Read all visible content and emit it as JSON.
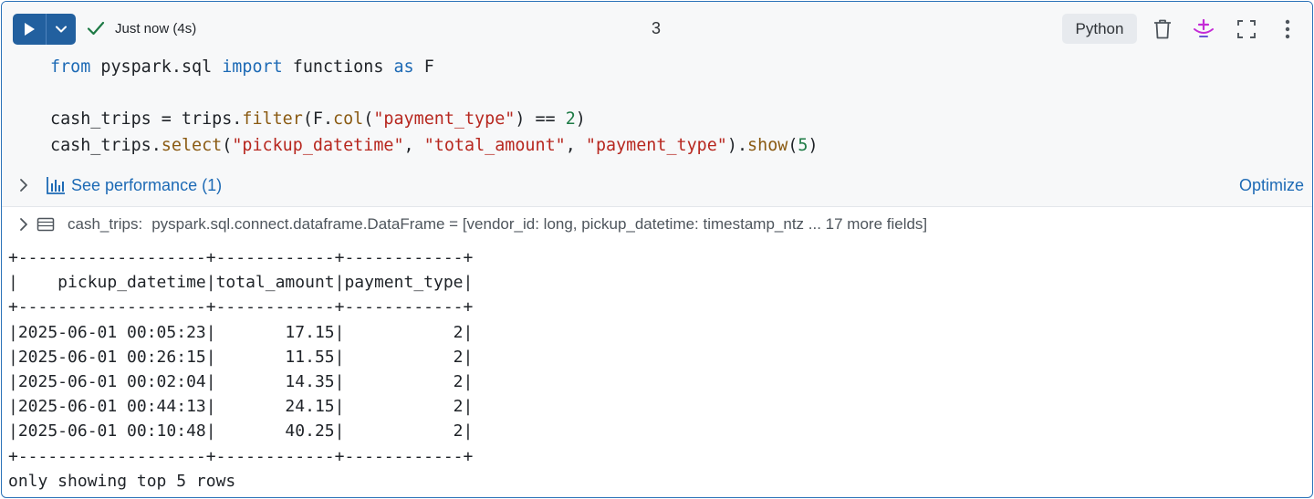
{
  "toolbar": {
    "status_text": "Just now (4s)",
    "cell_number": "3",
    "language": "Python",
    "icons": [
      "play-icon",
      "chevron-down-icon",
      "check-icon",
      "trash-icon",
      "assistant-sparkle-icon",
      "expand-icon",
      "more-vertical-icon"
    ]
  },
  "code": {
    "line1": {
      "kw_from": "from",
      "module": " pyspark.sql ",
      "kw_import": "import",
      "names": " functions ",
      "kw_as": "as",
      "alias": " F"
    },
    "line3": {
      "lhs": "cash_trips = trips.",
      "method": "filter",
      "open": "(F.",
      "col_fn": "col",
      "paren": "(",
      "arg": "\"payment_type\"",
      "mid": ") == ",
      "value": "2",
      "close": ")"
    },
    "line4": {
      "obj": "cash_trips.",
      "method": "select",
      "open": "(",
      "arg1": "\"pickup_datetime\"",
      "sep1": ", ",
      "arg2": "\"total_amount\"",
      "sep2": ", ",
      "arg3": "\"payment_type\"",
      "mid": ").",
      "show_fn": "show",
      "open2": "(",
      "show_n": "5",
      "close": ")"
    }
  },
  "performance": {
    "label": "See performance (1)",
    "optimize_label": "Optimize"
  },
  "output": {
    "var_name": "cash_trips:",
    "schema": "pyspark.sql.connect.dataframe.DataFrame = [vendor_id: long, pickup_datetime: timestamp_ntz ... 17 more fields]",
    "stdout_lines": [
      "+-------------------+------------+------------+",
      "|    pickup_datetime|total_amount|payment_type|",
      "+-------------------+------------+------------+",
      "|2025-06-01 00:05:23|       17.15|           2|",
      "|2025-06-01 00:26:15|       11.55|           2|",
      "|2025-06-01 00:02:04|       14.35|           2|",
      "|2025-06-01 00:44:13|       24.15|           2|",
      "|2025-06-01 00:10:48|       40.25|           2|",
      "+-------------------+------------+------------+",
      "only showing top 5 rows"
    ]
  },
  "colors": {
    "accent": "#22609f",
    "link": "#1d6ab5",
    "check": "#1d7a45",
    "assistant": "#c42bd6"
  }
}
